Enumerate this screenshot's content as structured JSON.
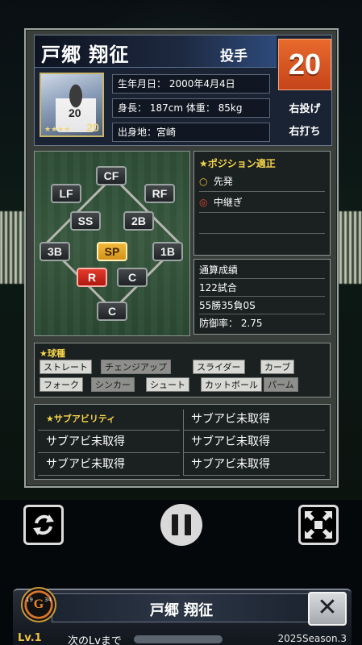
{
  "player": {
    "name": "戸郷 翔征",
    "position": "投手",
    "number": "20",
    "throws": "右投げ",
    "bats": "右打ち",
    "birthday": "生年月日： 2000年4月4日",
    "body": "身長： 187cm 体重： 85kg",
    "hometown": "出身地：宮崎",
    "portrait_jersey_number": "20",
    "portrait_corner_number": "20",
    "portrait_stars": "★★★★"
  },
  "positions": {
    "CF": "CF",
    "LF": "LF",
    "RF": "RF",
    "SS": "SS",
    "2B": "2B",
    "3B": "3B",
    "SP": "SP",
    "1B": "1B",
    "R": "R",
    "C_mid": "C",
    "C_bottom": "C"
  },
  "aptitude": {
    "title": "★ポジション適正",
    "rows": [
      {
        "mark": "○",
        "label": "先発"
      },
      {
        "mark": "◎",
        "label": "中継ぎ"
      }
    ]
  },
  "career": {
    "title": "通算成績",
    "games": "122試合",
    "record": "55勝35負0S",
    "era": "防御率： 2.75"
  },
  "pitches": {
    "title": "★球種",
    "row1": [
      "ストレート",
      "チェンジアップ",
      "スライダー",
      "カーブ"
    ],
    "row2": [
      "フォーク",
      "シンカー",
      "シュート",
      "カットボール",
      "パーム"
    ]
  },
  "sub_ability": {
    "title": "★サブアビリティ",
    "cells": [
      "サブアビ未取得",
      "サブアビ未取得",
      "サブアビ未取得",
      "サブアビ未取得",
      "サブアビ未取得"
    ]
  },
  "controls": {
    "refresh_icon": "refresh-icon",
    "pause_icon": "pause-icon",
    "fullscreen_icon": "collapse-icon"
  },
  "bottom": {
    "name": "戸郷 翔征",
    "close_label": "✕",
    "level": "Lv.1",
    "next_level": "次のLvまで",
    "season": "2025Season.3",
    "logo_letter": "G",
    "logo_year_left": "19",
    "logo_year_right": "34"
  },
  "colors": {
    "number_box": "#d9521f",
    "accent_gold": "#f6d64a",
    "sp_highlight": "#f2b93c",
    "r_highlight": "#e33a2c"
  }
}
